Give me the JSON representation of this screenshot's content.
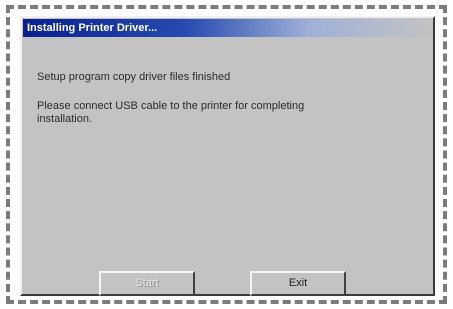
{
  "dialog": {
    "title": "Installing Printer Driver...",
    "message_line1": "Setup program copy driver files finished",
    "message_line2": "Please connect USB cable to the printer for completing installation."
  },
  "buttons": {
    "left_label": "Start",
    "exit_label": "Exit"
  }
}
